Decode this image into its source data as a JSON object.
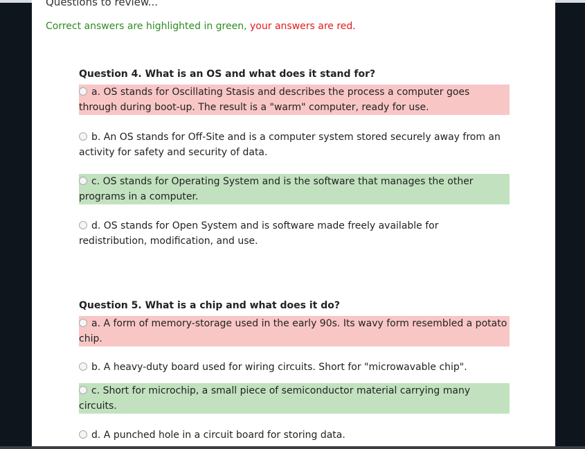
{
  "header": {
    "title": "Questions to review...",
    "legend_correct": "Correct answers are highlighted in green,",
    "legend_yours": "your answers are red."
  },
  "questions": [
    {
      "title": "Question 4. What is an OS and what does it stand for?",
      "options": [
        {
          "text": "a. OS stands for Oscillating Stasis and describes the process a computer goes through during boot-up. The result is a \"warm\" computer, ready for use.",
          "state": "wrong"
        },
        {
          "text": "b. An OS stands for Off-Site and is a computer system stored securely away from an activity for safety and security of data.",
          "state": "none"
        },
        {
          "text": "c. OS stands for Operating System and is the software that manages the other programs in a computer.",
          "state": "correct"
        },
        {
          "text": "d. OS stands for Open System and is software made freely available for redistribution, modification, and use.",
          "state": "none"
        }
      ]
    },
    {
      "title": "Question 5. What is a chip and what does it do?",
      "options": [
        {
          "text": "a. A form of memory-storage used in the early 90s. Its wavy form resembled a potato chip.",
          "state": "wrong"
        },
        {
          "text": "b. A heavy-duty board used for wiring circuits. Short for \"microwavable chip\".",
          "state": "none"
        },
        {
          "text": "c. Short for microchip, a small piece of semiconductor material carrying many circuits.",
          "state": "correct"
        },
        {
          "text": "d. A punched hole in a circuit board for storing data.",
          "state": "none"
        }
      ]
    }
  ],
  "colors": {
    "correct_bg": "#c2e2bf",
    "wrong_bg": "#f9c6c6",
    "legend_green": "#2e8b22",
    "legend_red": "#e01b1b"
  }
}
